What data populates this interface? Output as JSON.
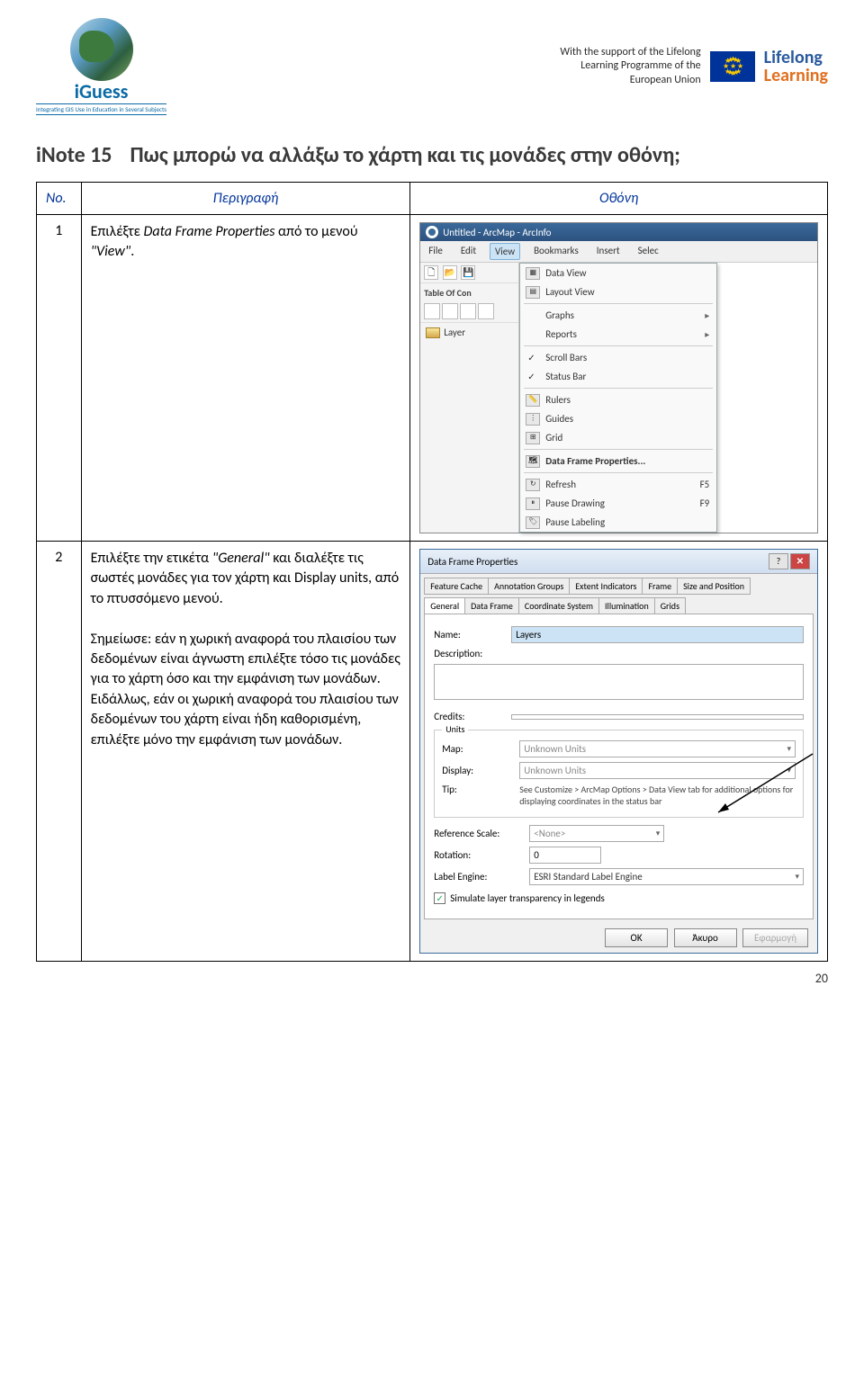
{
  "header": {
    "logo_brand": "iGuess",
    "logo_tag": "Integrating GIS Use in Education in Several Subjects",
    "support_l1": "With the support of the Lifelong",
    "support_l2": "Learning Programme of the",
    "support_l3": "European Union",
    "lifelong_l1": "Lifelong",
    "lifelong_l2": "Learning"
  },
  "title": {
    "label": "iNote 15",
    "question": "Πως μπορώ να αλλάξω το χάρτη και τις μονάδες στην οθόνη;"
  },
  "table": {
    "h_no": "No.",
    "h_desc": "Περιγραφή",
    "h_screen": "Οθόνη",
    "row1": {
      "no": "1",
      "t1": "Επιλέξτε ",
      "t2": "Data Frame Properties",
      "t3": " από το μενού ",
      "t4": "\"View\"",
      "t5": "."
    },
    "row2": {
      "no": "2",
      "t1": "Επιλέξτε την ετικέτα ",
      "t2": "\"General\"",
      "t3": " και διαλέξτε τις σωστές μονάδες για τον χάρτη και Display units, από το πτυσσόμενο μενού.",
      "t4": "Σημείωσε: εάν η χωρική αναφορά του πλαισίου των δεδομένων είναι άγνωστη επιλέξτε τόσο τις μονάδες για το χάρτη όσο και την εμφάνιση των μονάδων. Ειδάλλως, εάν οι χωρική αναφορά του πλαισίου των δεδομένων του χάρτη είναι ήδη καθορισμένη, επιλέξτε μόνο την εμφάνιση των μονάδων."
    }
  },
  "arcmap": {
    "win_title": "Untitled - ArcMap - ArcInfo",
    "menu_file": "File",
    "menu_edit": "Edit",
    "menu_view": "View",
    "menu_bookmarks": "Bookmarks",
    "menu_insert": "Insert",
    "menu_selec": "Selec",
    "toc": "Table Of Con",
    "layer": "Layer",
    "dd_data_view": "Data View",
    "dd_layout_view": "Layout View",
    "dd_graphs": "Graphs",
    "dd_reports": "Reports",
    "dd_scroll": "Scroll Bars",
    "dd_status": "Status Bar",
    "dd_rulers": "Rulers",
    "dd_guides": "Guides",
    "dd_grid": "Grid",
    "dd_dfp": "Data Frame Properties...",
    "dd_refresh": "Refresh",
    "dd_refresh_k": "F5",
    "dd_pause_draw": "Pause Drawing",
    "dd_pause_draw_k": "F9",
    "dd_pause_label": "Pause Labeling"
  },
  "dfp": {
    "title": "Data Frame Properties",
    "tab_fc": "Feature Cache",
    "tab_ag": "Annotation Groups",
    "tab_ei": "Extent Indicators",
    "tab_fr": "Frame",
    "tab_sp": "Size and Position",
    "tab_gen": "General",
    "tab_df": "Data Frame",
    "tab_cs": "Coordinate System",
    "tab_ill": "Illumination",
    "tab_gr": "Grids",
    "l_name": "Name:",
    "v_name": "Layers",
    "l_desc": "Description:",
    "l_credits": "Credits:",
    "fs_units": "Units",
    "l_map": "Map:",
    "v_map": "Unknown Units",
    "l_display": "Display:",
    "v_display": "Unknown Units",
    "l_tip": "Tip:",
    "tip_text": "See Customize > ArcMap Options > Data View tab for additional options for displaying coordinates in the status bar",
    "l_refscale": "Reference Scale:",
    "v_refscale": "<None>",
    "l_rotation": "Rotation:",
    "v_rotation": "0",
    "l_engine": "Label Engine:",
    "v_engine": "ESRI Standard Label Engine",
    "cb_sim": "Simulate layer transparency in legends",
    "btn_ok": "OK",
    "btn_cancel": "Άκυρο",
    "btn_apply": "Εφαρμογή"
  },
  "pagenum": "20"
}
